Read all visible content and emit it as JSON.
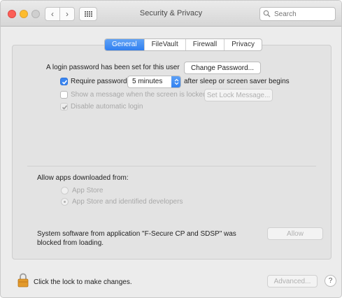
{
  "window": {
    "title": "Security & Privacy"
  },
  "toolbar": {
    "back_icon": "chevron-left-icon",
    "forward_icon": "chevron-right-icon",
    "grid_icon": "show-all-grid-icon",
    "search_placeholder": "Search"
  },
  "tabs": [
    {
      "label": "General",
      "active": true
    },
    {
      "label": "FileVault",
      "active": false
    },
    {
      "label": "Firewall",
      "active": false
    },
    {
      "label": "Privacy",
      "active": false
    }
  ],
  "general": {
    "password_set_text": "A login password has been set for this user",
    "change_password_button": "Change Password...",
    "require_password_label": "Require password",
    "require_password_checked": true,
    "require_password_delay": "5 minutes",
    "require_password_suffix": "after sleep or screen saver begins",
    "show_message_label": "Show a message when the screen is locked",
    "show_message_checked": false,
    "set_lock_message_button": "Set Lock Message...",
    "disable_auto_login_label": "Disable automatic login",
    "disable_auto_login_checked": true
  },
  "apps": {
    "heading": "Allow apps downloaded from:",
    "options": [
      {
        "label": "App Store",
        "selected": false
      },
      {
        "label": "App Store and identified developers",
        "selected": true
      }
    ]
  },
  "blocked": {
    "text_line1": "System software from application \"F-Secure CP and SDSP\" was",
    "text_line2": "blocked from loading.",
    "allow_button": "Allow"
  },
  "footer": {
    "lock_text": "Click the lock to make changes.",
    "advanced_button": "Advanced...",
    "help_label": "?"
  },
  "colors": {
    "accent": "#2f7ff0",
    "close": "#fc5f57",
    "minimize": "#fdbc2e"
  }
}
